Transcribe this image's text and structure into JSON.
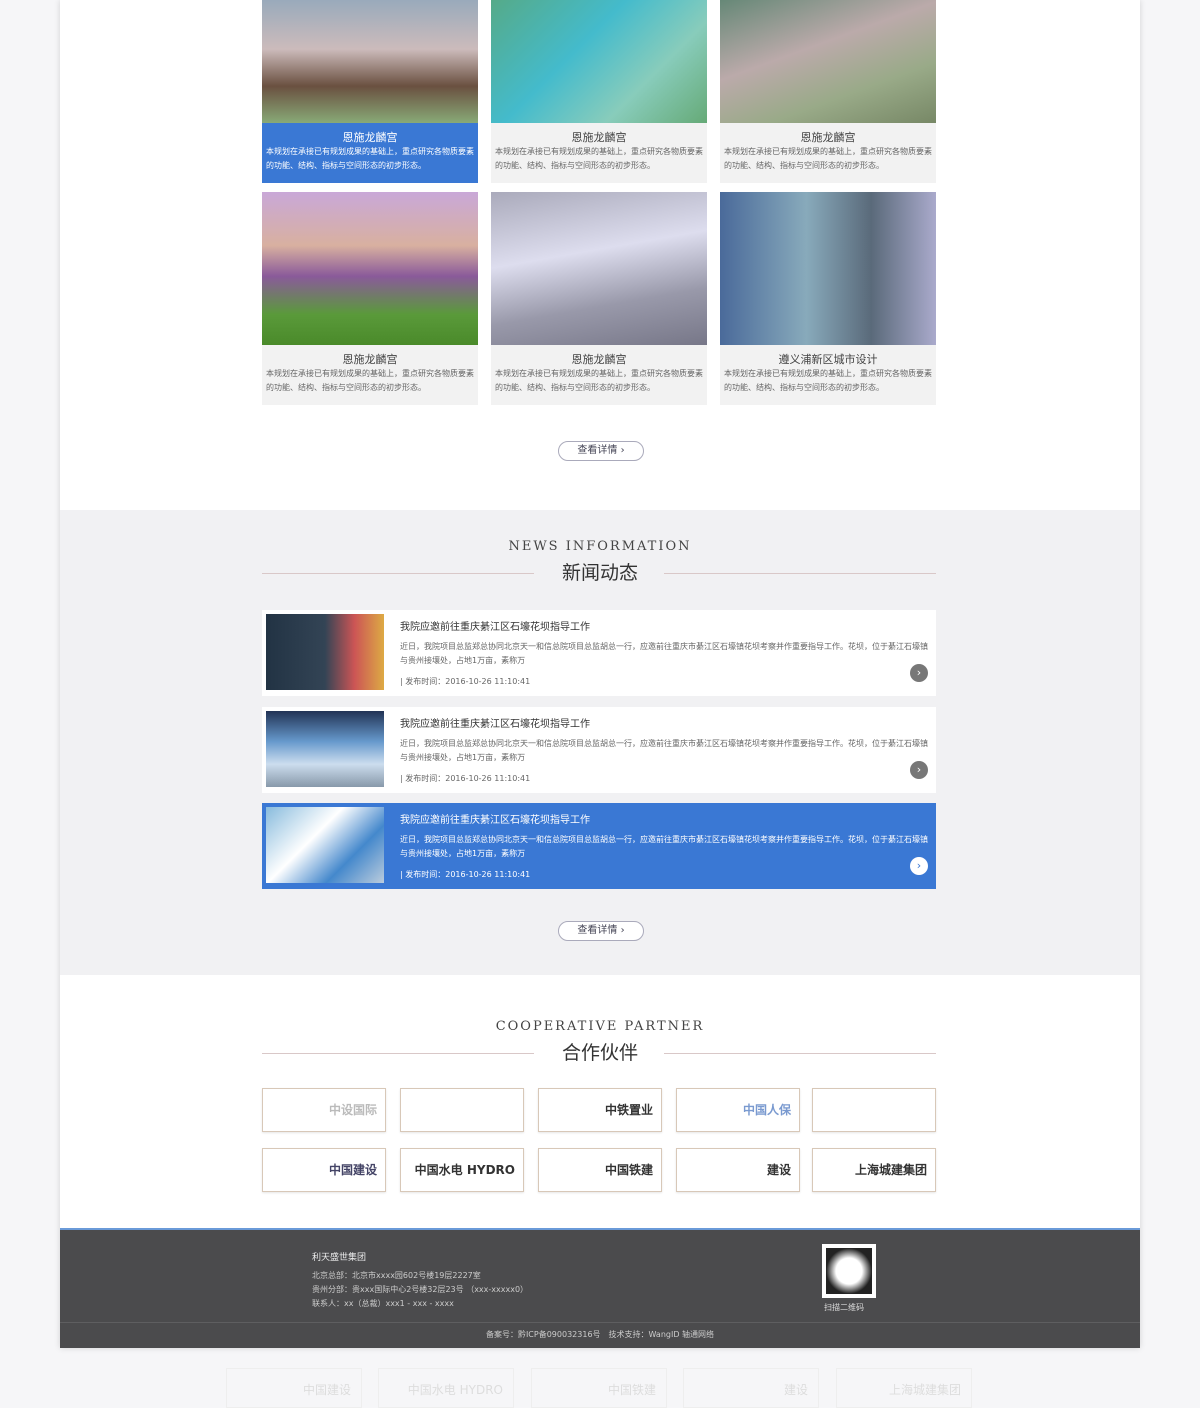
{
  "projects": [
    {
      "title": "恩施龙麟宫",
      "desc": "本规划在承接已有规划成果的基础上，重点研究各物质要素的功能、结构、指标与空间形态的初步形态。",
      "active": true
    },
    {
      "title": "恩施龙麟宫",
      "desc": "本规划在承接已有规划成果的基础上，重点研究各物质要素的功能、结构、指标与空间形态的初步形态。"
    },
    {
      "title": "恩施龙麟宫",
      "desc": "本规划在承接已有规划成果的基础上，重点研究各物质要素的功能、结构、指标与空间形态的初步形态。"
    },
    {
      "title": "恩施龙麟宫",
      "desc": "本规划在承接已有规划成果的基础上，重点研究各物质要素的功能、结构、指标与空间形态的初步形态。"
    },
    {
      "title": "恩施龙麟宫",
      "desc": "本规划在承接已有规划成果的基础上，重点研究各物质要素的功能、结构、指标与空间形态的初步形态。"
    },
    {
      "title": "遵义浦新区城市设计",
      "desc": "本规划在承接已有规划成果的基础上，重点研究各物质要素的功能、结构、指标与空间形态的初步形态。"
    }
  ],
  "more_label": "查看详情 ›",
  "news_section": {
    "en": "NEWS INFORMATION",
    "cn": "新闻动态"
  },
  "news": [
    {
      "title": "我院应邀前往重庆綦江区石壕花坝指导工作",
      "desc": "近日，我院项目总监郑总协同北京天一和信总院项目总监胡总一行，应邀前往重庆市綦江区石壕镇花坝考察并作重要指导工作。花坝，位于綦江石壕镇与贵州接壤处，占地1万亩，素称万",
      "time": "| 发布时间：2016-10-26 11:10:41"
    },
    {
      "title": "我院应邀前往重庆綦江区石壕花坝指导工作",
      "desc": "近日，我院项目总监郑总协同北京天一和信总院项目总监胡总一行，应邀前往重庆市綦江区石壕镇花坝考察并作重要指导工作。花坝，位于綦江石壕镇与贵州接壤处，占地1万亩，素称万",
      "time": "| 发布时间：2016-10-26 11:10:41"
    },
    {
      "title": "我院应邀前往重庆綦江区石壕花坝指导工作",
      "desc": "近日，我院项目总监郑总协同北京天一和信总院项目总监胡总一行，应邀前往重庆市綦江区石壕镇花坝考察并作重要指导工作。花坝，位于綦江石壕镇与贵州接壤处，占地1万亩，素称万",
      "time": "| 发布时间：2016-10-26 11:10:41",
      "active": true
    }
  ],
  "partner_section": {
    "en": "COOPERATIVE PARTNER",
    "cn": "合作伙伴"
  },
  "partners": [
    "中设国际",
    "",
    "中铁置业",
    "中国人保",
    "",
    "中国建设",
    "中国水电 HYDRO",
    "中国铁建",
    "建设",
    "上海城建集团"
  ],
  "footer": {
    "company": "利天盛世集团",
    "lines": [
      "北京总部：北京市xxxx园602号楼19层2227室",
      "贵州分部：贵xxx国际中心2号楼32层23号 （xxx-xxxxx0）",
      "联系人：xx（总裁）xxx1 - xxx - xxxx"
    ],
    "qr_label": "扫描二维码",
    "copyright": "备案号：黔ICP备090032316号　技术支持：WangID 轴通网络"
  },
  "colors": {
    "accent": "#3a78d4",
    "footer": "#4b4b4d"
  }
}
